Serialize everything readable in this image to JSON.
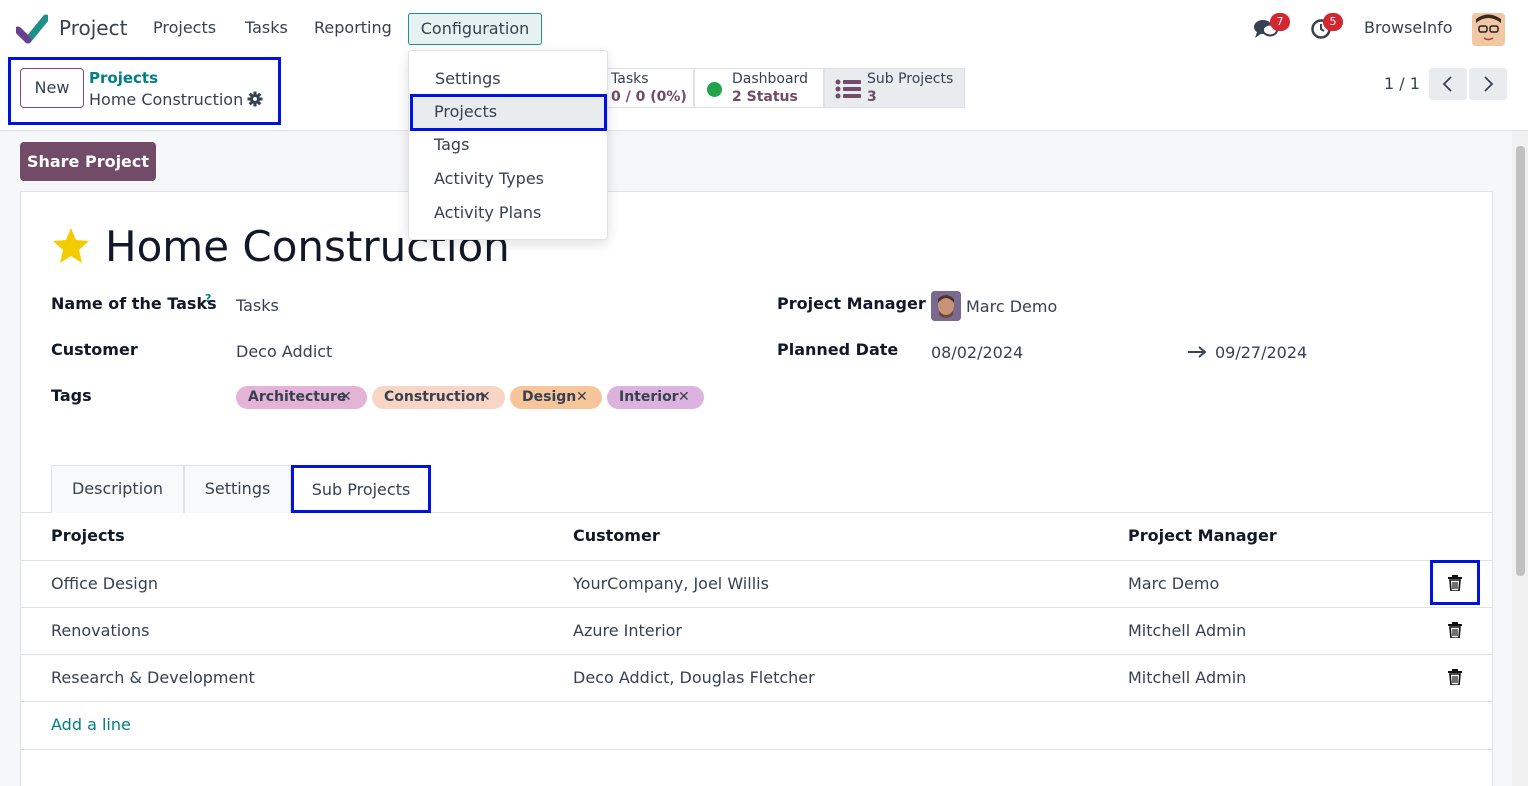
{
  "navbar": {
    "app_name": "Project",
    "menu": [
      "Projects",
      "Tasks",
      "Reporting",
      "Configuration"
    ],
    "messages_count": "7",
    "activities_count": "5",
    "company": "BrowseInfo"
  },
  "control_panel": {
    "new_label": "New",
    "breadcrumb_parent": "Projects",
    "breadcrumb_current": "Home Construction",
    "smart_buttons": [
      {
        "label": "Tasks",
        "value": "0 / 0 (0%)"
      },
      {
        "label": "Dashboard",
        "value": "2 Status"
      },
      {
        "label": "Sub Projects",
        "value": "3"
      }
    ],
    "pager": "1 / 1"
  },
  "config_dropdown": {
    "items": [
      "Settings",
      "Projects",
      "Tags",
      "Activity Types",
      "Activity Plans"
    ]
  },
  "form": {
    "share_label": "Share Project",
    "title": "Home Construction",
    "tasks_label": "Name of the Tasks",
    "tasks_help": "?",
    "tasks_value": "Tasks",
    "customer_label": "Customer",
    "customer_value": "Deco Addict",
    "tags_label": "Tags",
    "tags": [
      "Architecture",
      "Construction",
      "Design",
      "Interior"
    ],
    "manager_label": "Project Manager",
    "manager_value": "Marc Demo",
    "planned_label": "Planned Date",
    "date_start": "08/02/2024",
    "date_end": "09/27/2024"
  },
  "tabs": [
    "Description",
    "Settings",
    "Sub Projects"
  ],
  "sub_projects": {
    "columns": [
      "Projects",
      "Customer",
      "Project Manager"
    ],
    "rows": [
      {
        "project": "Office Design",
        "customer": "YourCompany, Joel Willis",
        "manager": "Marc Demo"
      },
      {
        "project": "Renovations",
        "customer": "Azure Interior",
        "manager": "Mitchell Admin"
      },
      {
        "project": "Research & Development",
        "customer": "Deco Addict, Douglas Fletcher",
        "manager": "Mitchell Admin"
      }
    ],
    "add_line": "Add a line"
  },
  "colors": {
    "primary": "#714b67",
    "link": "#017e84",
    "highlight": "#0012e0",
    "tag_architecture": "#e4b4d7",
    "tag_construction": "#f9d5c5",
    "tag_design": "#f6c59a",
    "tag_interior": "#dcb3df"
  }
}
